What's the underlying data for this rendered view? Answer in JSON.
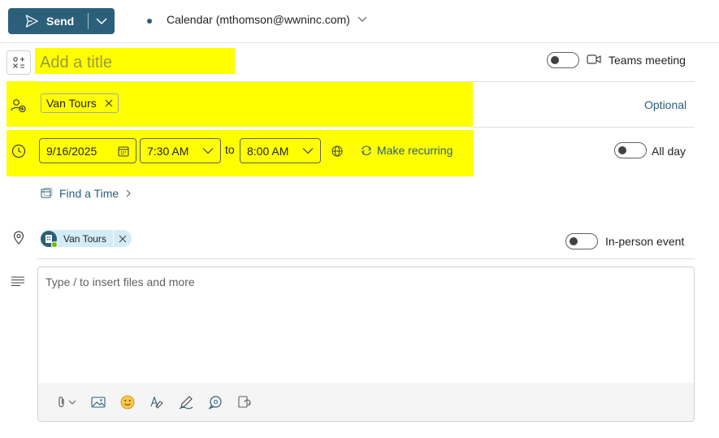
{
  "header": {
    "send_label": "Send",
    "calendar_label": "Calendar (mthomson@wwninc.com)"
  },
  "title": {
    "placeholder": "Add a title",
    "teams_label": "Teams meeting"
  },
  "attendees": {
    "chips": [
      "Van Tours"
    ],
    "optional_label": "Optional"
  },
  "time": {
    "start_date": "9/16/2025",
    "start_time": "7:30 AM",
    "to_label": "to",
    "end_time": "8:00 AM",
    "recurring_label": "Make recurring",
    "all_day_label": "All day",
    "find_time_label": "Find a Time"
  },
  "location": {
    "chip": "Van Tours",
    "in_person_label": "In-person event"
  },
  "body": {
    "placeholder": "Type / to insert files and more"
  },
  "colors": {
    "accent": "#2b5f7a",
    "highlight": "#ffff00",
    "presence": "#6bb700"
  },
  "icons": [
    "send-icon",
    "chevron-down-icon",
    "form-icon",
    "video-icon",
    "people-add-icon",
    "dismiss-icon",
    "clock-icon",
    "calendar-icon",
    "globe-icon",
    "recur-icon",
    "calendar-find-icon",
    "chevron-right-icon",
    "location-icon",
    "text-lines-icon",
    "attach-icon",
    "image-icon",
    "emoji-icon",
    "format-icon",
    "draw-icon",
    "chat-icon",
    "loop-icon"
  ]
}
